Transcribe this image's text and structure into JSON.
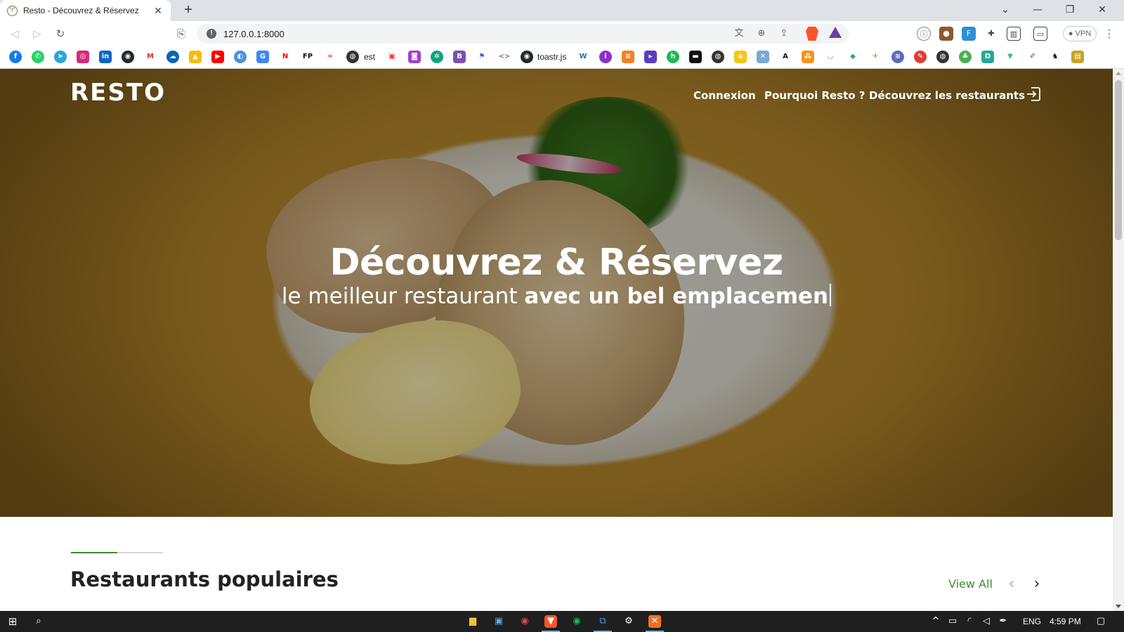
{
  "browser": {
    "tab_title": "Resto - Découvrez & Réservez",
    "url": "127.0.0.1:8000",
    "vpn_label": "VPN",
    "bookmark_labels": [
      "est",
      "toastr.js"
    ]
  },
  "site": {
    "logo": "RESTO",
    "nav": {
      "login": "Connexion",
      "why": "Pourquoi Resto ?",
      "discover": "Découvrez les restaurants"
    },
    "hero": {
      "title": "Découvrez & Réservez",
      "subtitle_plain": "le meilleur restaurant ",
      "subtitle_bold": "avec un bel emplacemen"
    },
    "popular": {
      "title": "Restaurants populaires",
      "view_all": "View All"
    }
  },
  "taskbar": {
    "language": "ENG",
    "time": "4:59 PM"
  },
  "colors": {
    "accent_green": "#3d8c2d",
    "taskbar": "#1f1f1f"
  },
  "icons": {
    "login": "login-arrow-icon",
    "prev": "chevron-left-icon",
    "next": "chevron-right-icon"
  }
}
